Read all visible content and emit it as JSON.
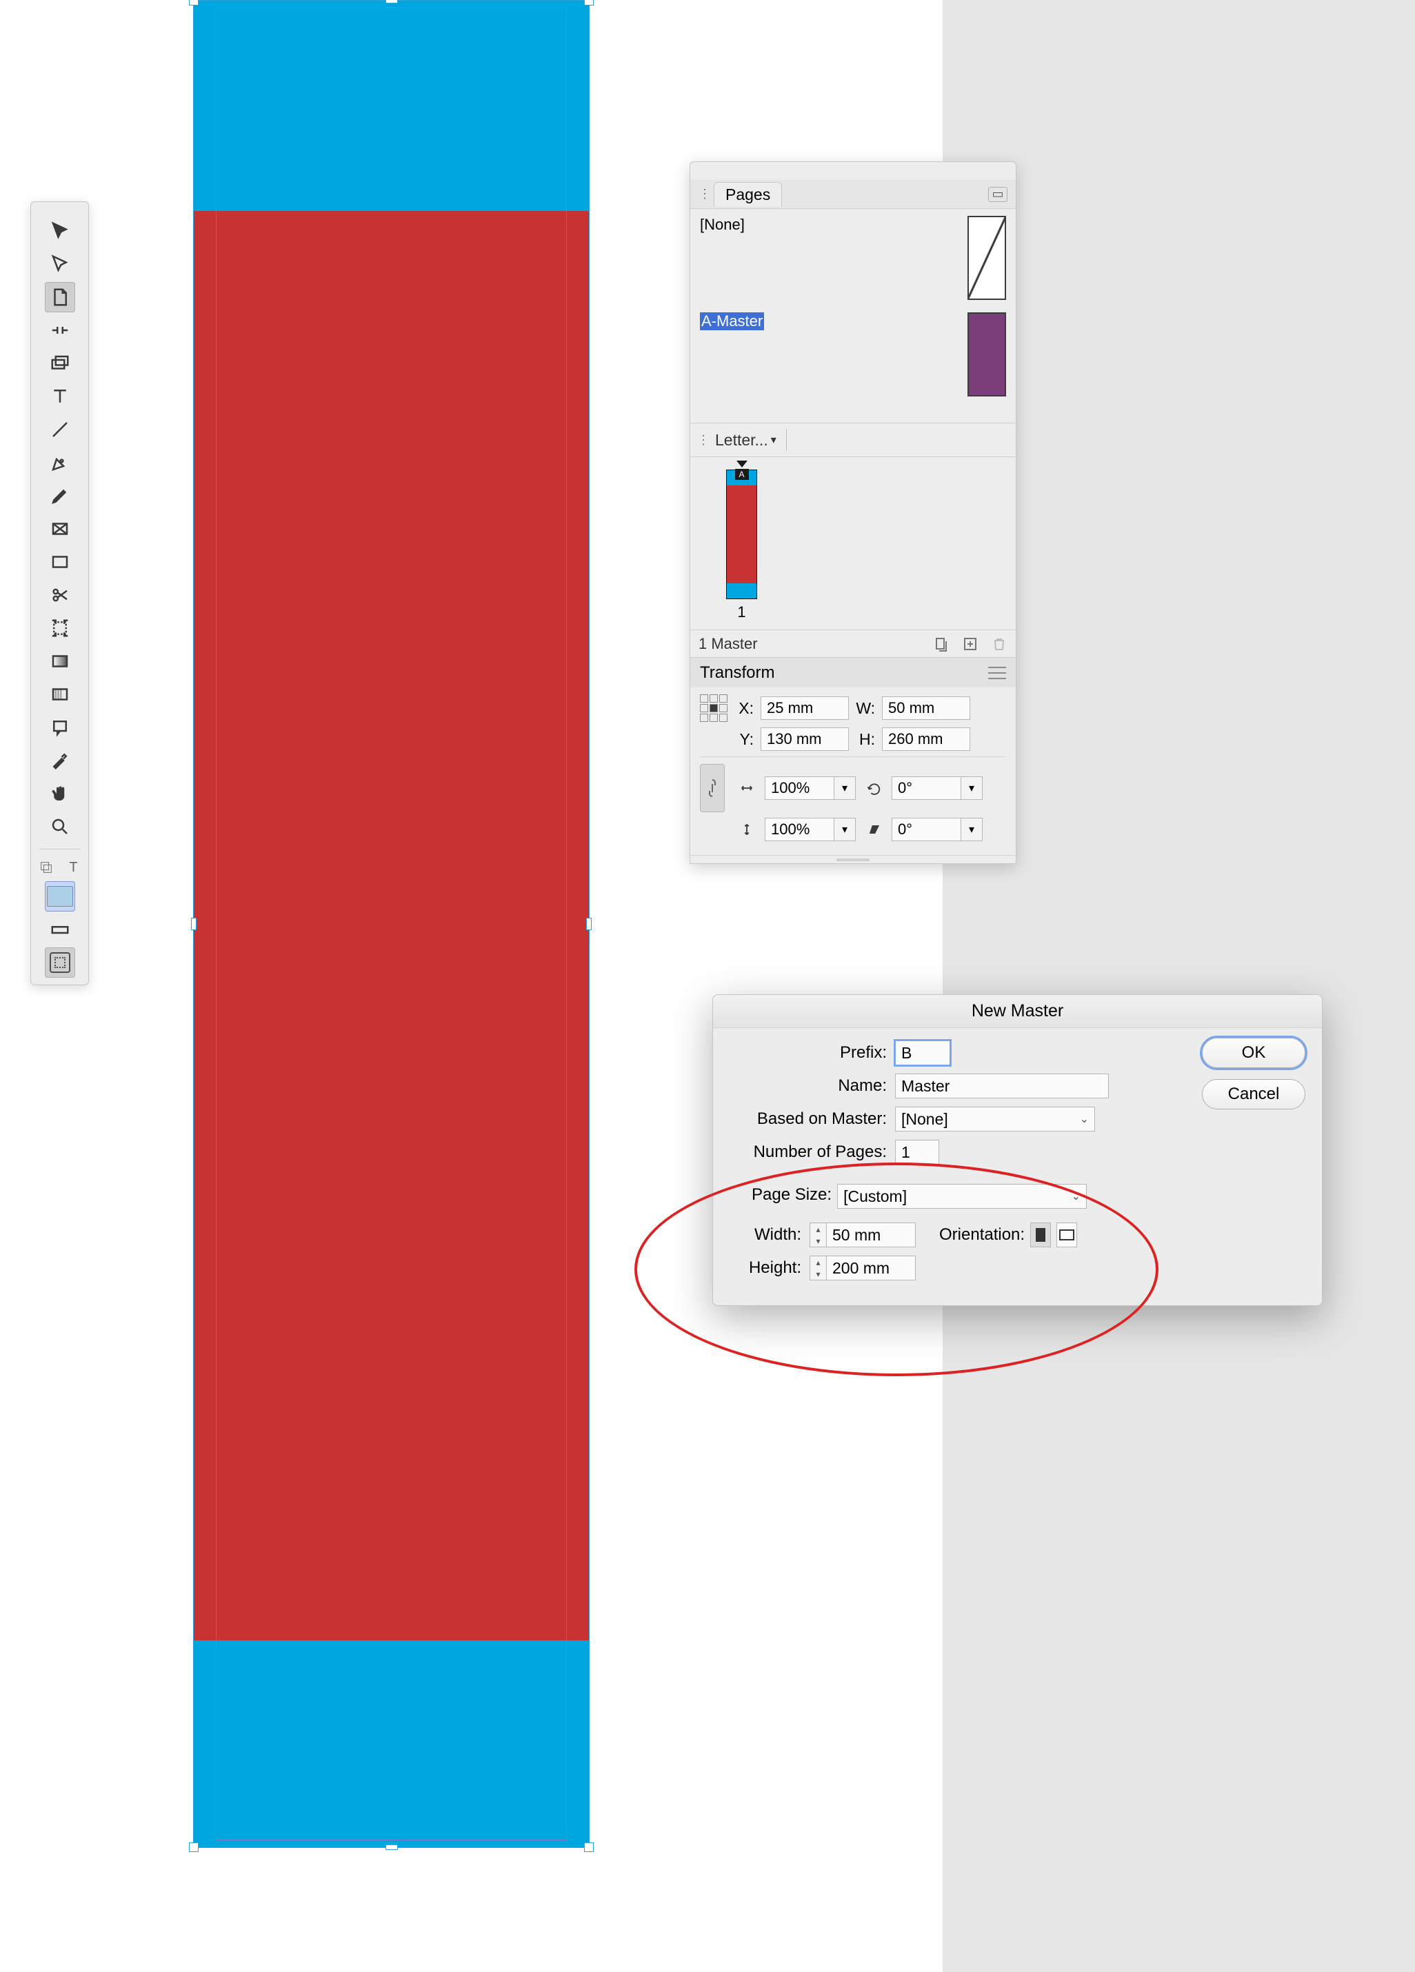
{
  "pages_panel": {
    "title": "Pages",
    "none_label": "[None]",
    "a_master_label": "A-Master",
    "letter_menu": "Letter...",
    "page1_badge": "A",
    "page1_num": "1",
    "footer": "1 Master"
  },
  "transform": {
    "title": "Transform",
    "x_label": "X:",
    "y_label": "Y:",
    "w_label": "W:",
    "h_label": "H:",
    "x": "25 mm",
    "y": "130 mm",
    "w": "50 mm",
    "h": "260 mm",
    "scale_x": "100%",
    "scale_y": "100%",
    "rotate": "0°",
    "shear": "0°"
  },
  "dialog": {
    "title": "New Master",
    "prefix_label": "Prefix:",
    "prefix_value": "B",
    "name_label": "Name:",
    "name_value": "Master",
    "based_label": "Based on Master:",
    "based_value": "[None]",
    "numpages_label": "Number of Pages:",
    "numpages_value": "1",
    "pagesize_heading": "Page Size:",
    "pagesize_value": "[Custom]",
    "width_label": "Width:",
    "width_value": "50 mm",
    "height_label": "Height:",
    "height_value": "200 mm",
    "orient_label": "Orientation:",
    "ok": "OK",
    "cancel": "Cancel"
  }
}
